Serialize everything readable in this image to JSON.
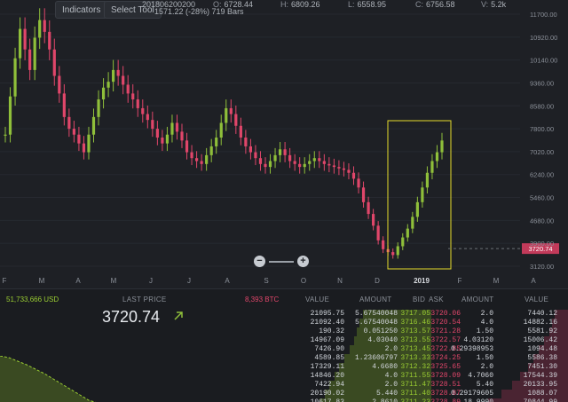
{
  "toolbar": {
    "indicators_label": "Indicators",
    "select_tool_label": "Select Tool"
  },
  "ohlc": {
    "time": "201806200200",
    "change": "1571.22 (-28%) 719 Bars",
    "open_label": "O:",
    "open": "6728.44",
    "high_label": "H:",
    "high": "6809.26",
    "low_label": "L:",
    "low": "6558.95",
    "close_label": "C:",
    "close": "6756.58",
    "volume_label": "V:",
    "volume": "5.2k"
  },
  "colors": {
    "up": "#8fbf3a",
    "down": "#e0466a",
    "highlight_box": "#e6dc2b",
    "price_tag": "#c23a5a"
  },
  "chart_data": {
    "type": "candlestick",
    "y_ticks": [
      "11700.00",
      "10920.00",
      "10140.00",
      "9360.00",
      "8580.00",
      "7800.00",
      "7020.00",
      "6240.00",
      "5460.00",
      "4680.00",
      "3900.00",
      "3120.00"
    ],
    "ylim": [
      3120,
      11700
    ],
    "x_ticks": [
      "F",
      "M",
      "A",
      "M",
      "J",
      "J",
      "A",
      "S",
      "O",
      "N",
      "D",
      "2019",
      "F",
      "M",
      "A"
    ],
    "current_price_tag": "3720.74",
    "close_series": [
      7600,
      8900,
      10200,
      11200,
      10500,
      9800,
      10900,
      11500,
      11100,
      10500,
      9600,
      9000,
      8200,
      7800,
      7600,
      7300,
      7000,
      7600,
      8200,
      8800,
      9200,
      9400,
      9800,
      9600,
      9300,
      9000,
      8800,
      8500,
      8300,
      8100,
      7800,
      7500,
      7300,
      7600,
      8000,
      7700,
      7400,
      7000,
      6800,
      6700,
      6600,
      6900,
      7200,
      7500,
      8000,
      8500,
      8300,
      7900,
      7500,
      7200,
      7000,
      6800,
      6600,
      6500,
      6700,
      6900,
      7100,
      6900,
      6700,
      6600,
      6500,
      6600,
      6700,
      6800,
      6700,
      6600,
      6550,
      6500,
      6450,
      6400,
      6300,
      6100,
      5800,
      5300,
      4900,
      4500,
      4000,
      3700,
      3600,
      3500,
      3800,
      4100,
      4400,
      4800,
      5300,
      5800,
      6300,
      6700,
      7000,
      7400
    ]
  },
  "zoom": {
    "zoom_out_label": "−",
    "zoom_in_label": "+"
  },
  "summary": {
    "volume_usd": "51,733,666 USD",
    "last_price_label": "LAST PRICE",
    "last_price": "3720.74",
    "volume_btc": "8,393 BTC"
  },
  "orderbook": {
    "headers": [
      "VALUE",
      "AMOUNT",
      "BID",
      "ASK",
      "AMOUNT",
      "VALUE"
    ],
    "rows": [
      [
        "21095.75",
        "5.67540048",
        "3717.05",
        "3720.06",
        "2.0",
        "7440.12"
      ],
      [
        "21092.40",
        "5.67540048",
        "3716.46",
        "3720.54",
        "4.0",
        "14882.16"
      ],
      [
        "190.32",
        "0.051250",
        "3713.57",
        "3721.28",
        "1.50",
        "5581.92"
      ],
      [
        "14967.09",
        "4.03040",
        "3713.55",
        "3722.57",
        "4.03120",
        "15006.42"
      ],
      [
        "7426.90",
        "2.0",
        "3713.45",
        "3722.85",
        "0.29398953",
        "1094.48"
      ],
      [
        "4589.85",
        "1.23606797",
        "3713.33",
        "3724.25",
        "1.50",
        "5586.38"
      ],
      [
        "17329.11",
        "4.6680",
        "3712.32",
        "3725.65",
        "2.0",
        "7451.30"
      ],
      [
        "14846.20",
        "4.0",
        "3711.55",
        "3728.09",
        "4.7060",
        "17544.39"
      ],
      [
        "7422.94",
        "2.0",
        "3711.47",
        "3728.51",
        "5.40",
        "20133.95"
      ],
      [
        "20190.02",
        "5.440",
        "3711.40",
        "3728.87",
        "0.29179605",
        "1088.07"
      ],
      [
        "10617.83",
        "2.8610",
        "3711.23",
        "3728.89",
        "18.9990",
        "70844.99"
      ]
    ],
    "bid_depth": [
      0.55,
      0.58,
      0.6,
      0.62,
      0.66,
      0.7,
      0.74,
      0.78,
      0.82,
      0.86,
      0.9
    ],
    "ask_depth": [
      0.1,
      0.12,
      0.14,
      0.18,
      0.22,
      0.26,
      0.3,
      0.36,
      0.42,
      0.5,
      0.6
    ]
  }
}
